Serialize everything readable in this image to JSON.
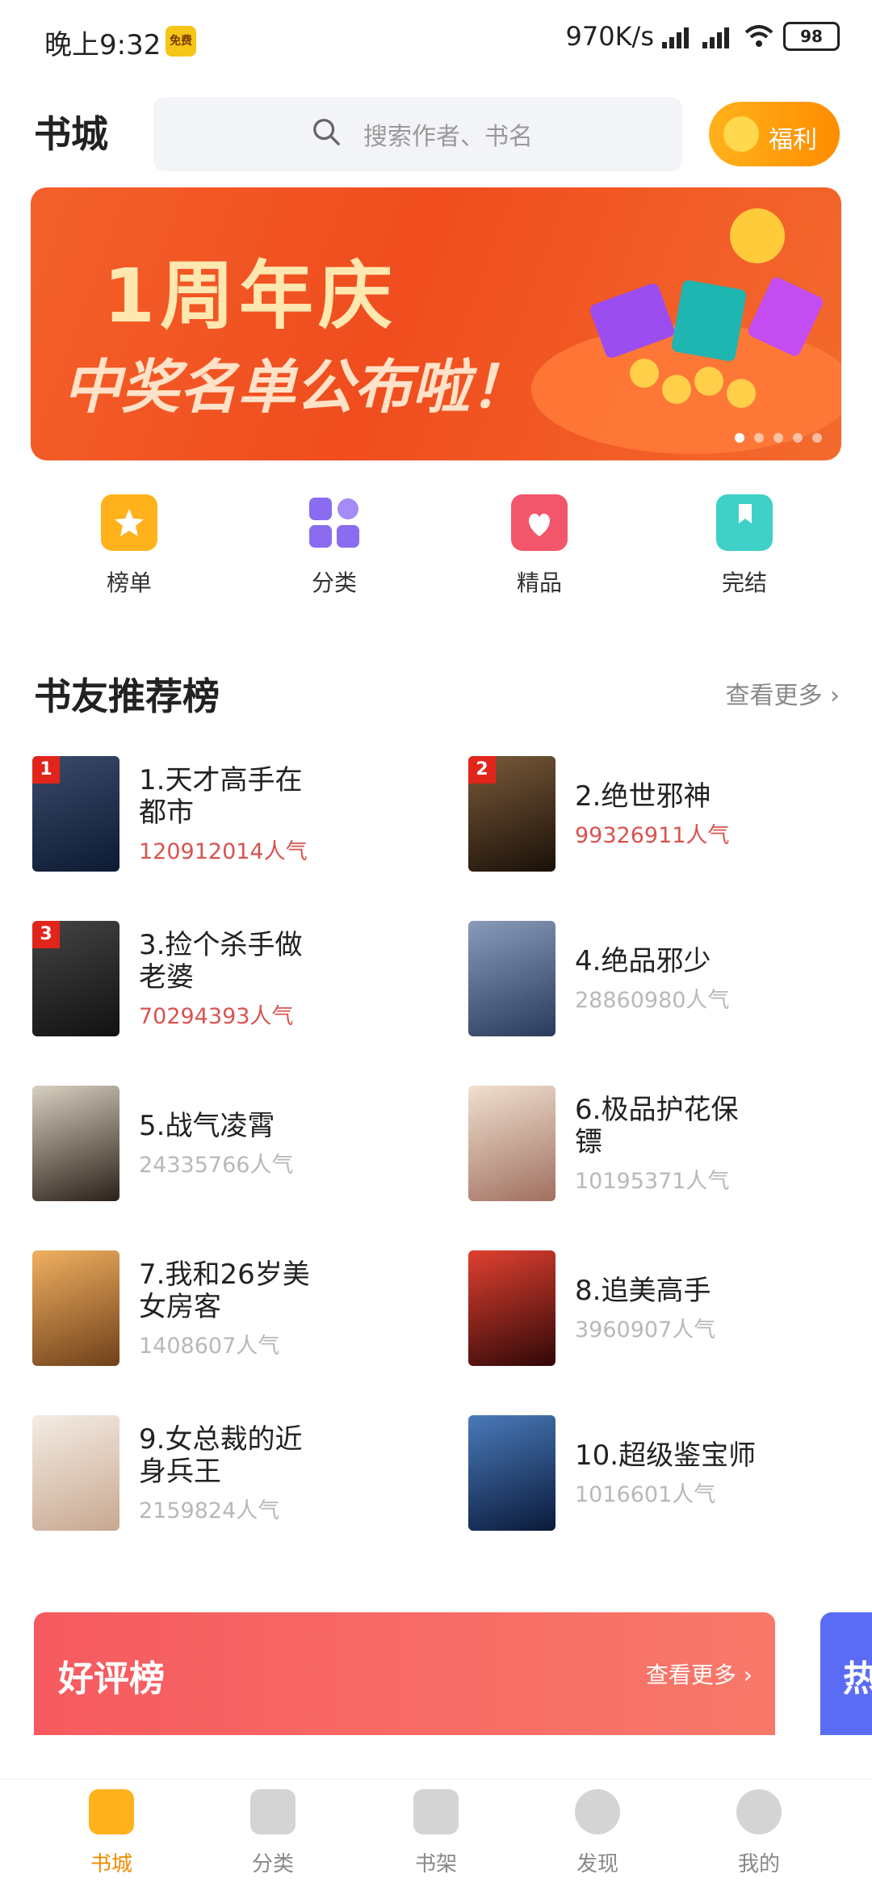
{
  "status": {
    "time": "晚上9:32",
    "free_badge": "免费",
    "speed": "970K/s",
    "battery": "98"
  },
  "header": {
    "title": "书城",
    "search_placeholder": "搜索作者、书名",
    "welfare": "福利"
  },
  "banner": {
    "line1": "1周年庆",
    "line2": "中奖名单公布啦！",
    "pages": 5,
    "active_page": 1
  },
  "quick_nav": [
    {
      "label": "榜单",
      "icon": "rank-icon",
      "color": "#ffb21c"
    },
    {
      "label": "分类",
      "icon": "category-icon",
      "color": "#8a6cf0"
    },
    {
      "label": "精品",
      "icon": "premium-icon",
      "color": "#f2566a"
    },
    {
      "label": "完结",
      "icon": "finished-icon",
      "color": "#3fd1c8"
    }
  ],
  "section": {
    "title": "书友推荐榜",
    "more": "查看更多"
  },
  "books": [
    {
      "title": "1.天才高手在都市",
      "pop": "120912014人气",
      "hot": true,
      "rank": "1",
      "cover": "#1d2b4a"
    },
    {
      "title": "2.绝世邪神",
      "pop": "99326911人气",
      "hot": true,
      "rank": "2",
      "cover": "#3a2a1a"
    },
    {
      "title": "3.捡个杀手做老婆",
      "pop": "70294393人气",
      "hot": true,
      "rank": "3",
      "cover": "#2b2b2b"
    },
    {
      "title": "4.绝品邪少",
      "pop": "28860980人气",
      "hot": false,
      "rank": "",
      "cover": "#4a5a7a"
    },
    {
      "title": "5.战气凌霄",
      "pop": "24335766人气",
      "hot": false,
      "rank": "",
      "cover": "#5a4a3a"
    },
    {
      "title": "6.极品护花保镖",
      "pop": "10195371人气",
      "hot": false,
      "rank": "",
      "cover": "#c9a9a0"
    },
    {
      "title": "7.我和26岁美女房客",
      "pop": "1408607人气",
      "hot": false,
      "rank": "",
      "cover": "#c0894a"
    },
    {
      "title": "8.追美高手",
      "pop": "3960907人气",
      "hot": false,
      "rank": "",
      "cover": "#8a1a1a"
    },
    {
      "title": "9.女总裁的近身兵王",
      "pop": "2159824人气",
      "hot": false,
      "rank": "",
      "cover": "#e8dcd0"
    },
    {
      "title": "10.超级鉴宝师",
      "pop": "1016601人气",
      "hot": false,
      "rank": "",
      "cover": "#1a3a6a"
    }
  ],
  "good_review": {
    "title": "好评榜",
    "more": "查看更多"
  },
  "hot_card": {
    "title": "热"
  },
  "tabs": [
    {
      "label": "书城",
      "active": true
    },
    {
      "label": "分类",
      "active": false
    },
    {
      "label": "书架",
      "active": false
    },
    {
      "label": "发现",
      "active": false
    },
    {
      "label": "我的",
      "active": false
    }
  ]
}
